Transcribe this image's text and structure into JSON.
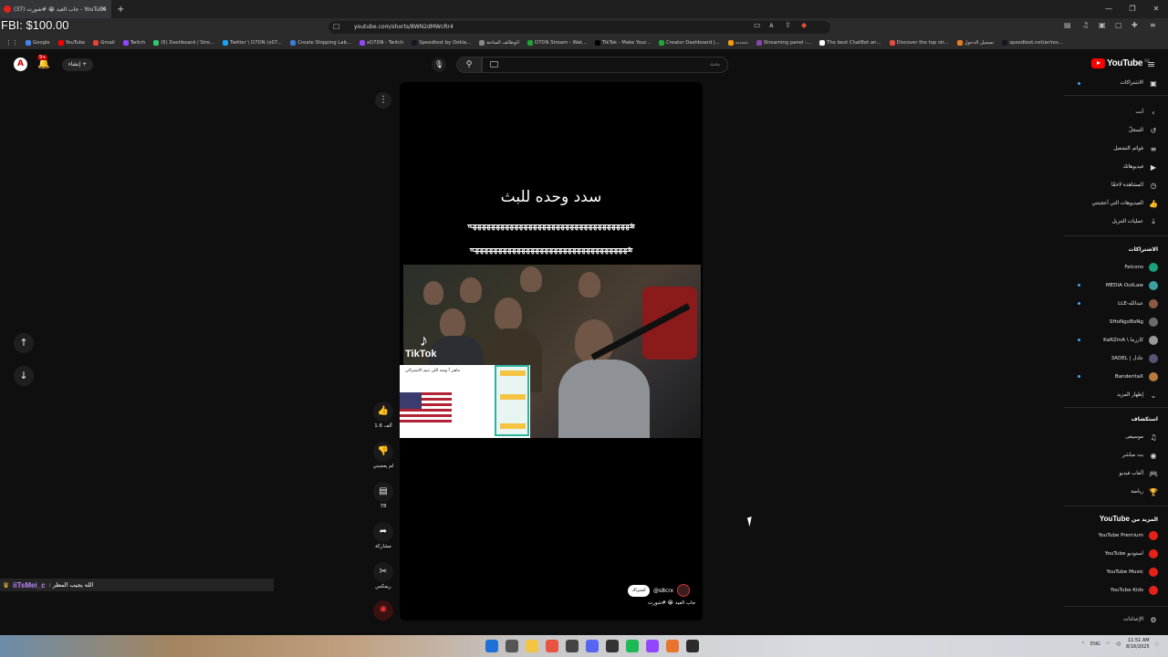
{
  "overlay": {
    "fbi": "FBI: $100.00"
  },
  "browser": {
    "tab_title": "(37) جاب العيد 😭 #شورت - YouTube",
    "url": "youtube.com/shorts/8WN2dMWcRr4",
    "bookmarks": [
      {
        "label": "Google",
        "color": "#4285f4"
      },
      {
        "label": "YouTube",
        "color": "#ff0000"
      },
      {
        "label": "Gmail",
        "color": "#ea4335"
      },
      {
        "label": "Twitch",
        "color": "#9146ff"
      },
      {
        "label": "(5) Dashboard / Stre...",
        "color": "#2ecc71"
      },
      {
        "label": "Twitter \\ D7DN (x07...",
        "color": "#1da1f2"
      },
      {
        "label": "Create Shipping Lab...",
        "color": "#3b7dd8"
      },
      {
        "label": "xD7DN - Twitch",
        "color": "#9146ff"
      },
      {
        "label": "Speedtest by Ookla...",
        "color": "#141526"
      },
      {
        "label": "الوظائف المتاحة",
        "color": "#888888"
      },
      {
        "label": "D7DN Stream - Wat...",
        "color": "#21a635"
      },
      {
        "label": "TikTok - Make Your...",
        "color": "#000000"
      },
      {
        "label": "Creator Dashboard |...",
        "color": "#21a635"
      },
      {
        "label": "دددددد",
        "color": "#f39c12"
      },
      {
        "label": "Streaming panel -...",
        "color": "#8e44ad"
      },
      {
        "label": "The best ChatBot an...",
        "color": "#ffffff"
      },
      {
        "label": "Discover the top str...",
        "color": "#e74c3c"
      },
      {
        "label": "تسجيل الدخول",
        "color": "#e67e22"
      },
      {
        "label": "speedtest.net/ar/res...",
        "color": "#141526"
      }
    ]
  },
  "masthead": {
    "create_label": "إنشاء",
    "notif_count": "9+",
    "search_placeholder": "بحث",
    "logo_text": "YouTube",
    "logo_region": "SA"
  },
  "sidebar": {
    "subscriptions_top": "الاشتراكات",
    "you_header": "أنت",
    "you_items": [
      {
        "label": "السجلّ",
        "icon": "history-icon",
        "glyph": "↺"
      },
      {
        "label": "قوائم التشغيل",
        "icon": "playlists-icon",
        "glyph": "≡"
      },
      {
        "label": "فيديوهاتك",
        "icon": "your-videos-icon",
        "glyph": "▶"
      },
      {
        "label": "المشاهدة لاحقًا",
        "icon": "watch-later-icon",
        "glyph": "◷"
      },
      {
        "label": "الفيديوهات التي أعجبتني",
        "icon": "liked-videos-icon",
        "glyph": "👍"
      },
      {
        "label": "عمليات التنزيل",
        "icon": "downloads-icon",
        "glyph": "⤓"
      }
    ],
    "subs_header": "الاشتراكات",
    "channels": [
      {
        "label": "Falcons",
        "color": "#1aa179",
        "dot": false
      },
      {
        "label": "MEDIA OutLaw",
        "color": "#3aa0a0",
        "dot": true
      },
      {
        "label": "LLE-عبدالله",
        "color": "#8a5a44",
        "dot": true
      },
      {
        "label": "SHoNgxBoNg",
        "color": "#6b6b6b",
        "dot": false
      },
      {
        "label": "KaRZmA \\ كارزما",
        "color": "#999999",
        "dot": true
      },
      {
        "label": "3ADEL | عادل",
        "color": "#555577",
        "dot": false
      },
      {
        "label": "BanderitaX",
        "color": "#b57a3c",
        "dot": true
      }
    ],
    "show_more": "إظهار المزيد",
    "explore_header": "استكشاف",
    "explore_items": [
      {
        "label": "موسيقى",
        "icon": "music-icon",
        "glyph": "♫"
      },
      {
        "label": "بث مباشر",
        "icon": "live-icon",
        "glyph": "◉"
      },
      {
        "label": "ألعاب فيديو",
        "icon": "gaming-icon",
        "glyph": "🎮"
      },
      {
        "label": "رياضة",
        "icon": "sports-icon",
        "glyph": "🏆"
      }
    ],
    "more_header_prefix": "المزيد من",
    "more_header_brand": "YouTube",
    "more_items": [
      {
        "label": "YouTube Premium"
      },
      {
        "label": "YouTube استوديو"
      },
      {
        "label": "YouTube Music"
      },
      {
        "label": "YouTube Kids"
      }
    ],
    "settings": "الإعدادات"
  },
  "player": {
    "title": "سدد وحده للبث",
    "strike_line1": "هههههههههههههههههههههههههههههههههههه",
    "strike_line2": "ههههههههههههههههههههههههههههههههههه",
    "tiktok_label": "TikTok",
    "overlay_text": "ماهي آ وشه اللي تبيم الاشتراكي",
    "channel_handle": "@s8crx",
    "subscribe_label": "اشتراك",
    "caption": "جاب العيد 😭 #شورت"
  },
  "actions": {
    "like_count": "1.6 ألف",
    "dislike_label": "لم يعجبني",
    "comments_count": "78",
    "share_label": "مشاركة",
    "remix_label": "ريمكس"
  },
  "chat": {
    "user": "iiTsMei_c",
    "message": ": الله يجيب المطر"
  },
  "taskbar": {
    "lang": "ENG",
    "time": "11:51 AM",
    "date": "8/16/2025"
  }
}
